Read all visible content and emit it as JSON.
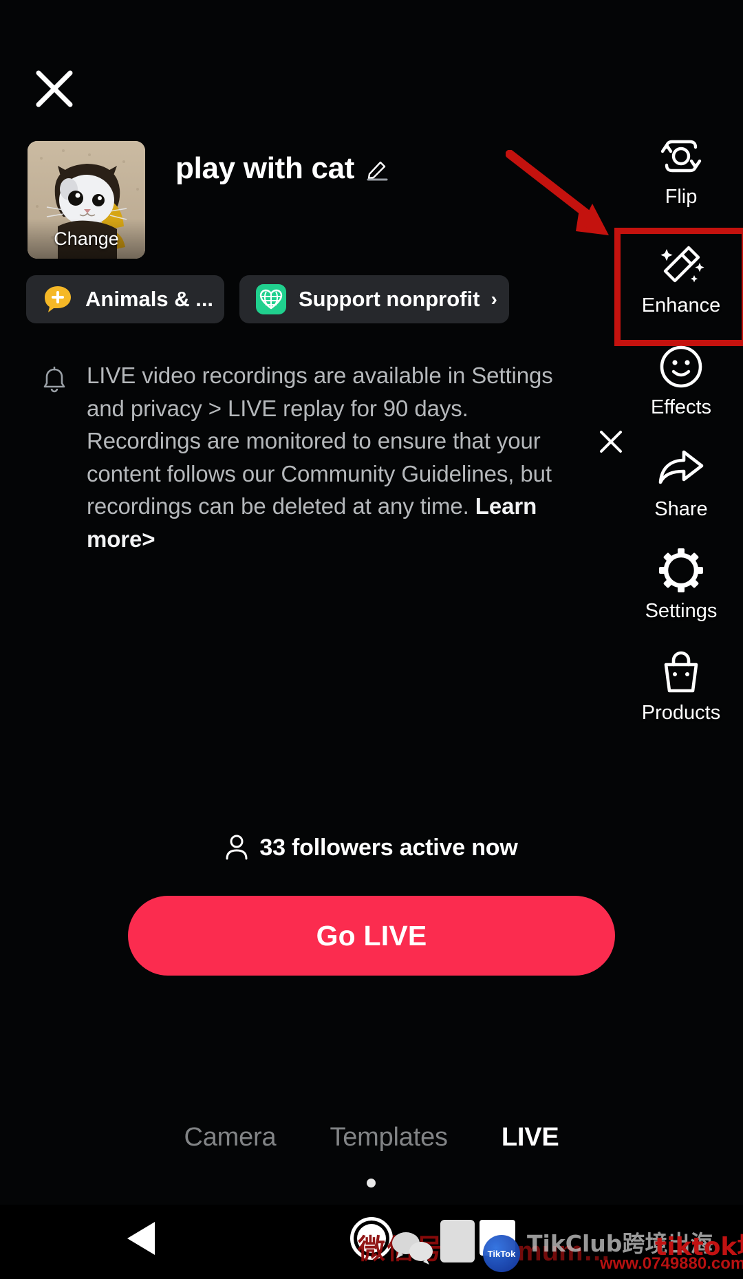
{
  "app": {
    "screen_name": "TikTok LIVE setup",
    "background_color": "#040506"
  },
  "header": {
    "close_icon": "close-icon",
    "cover": {
      "change_label": "Change",
      "alt": "cat thumbnail"
    },
    "title": "play with cat",
    "edit_icon": "pencil-icon"
  },
  "chips": [
    {
      "id": "category",
      "label": "Animals & ...",
      "icon": "topic-plus-icon",
      "icon_color": "#f5b827",
      "chevron": ""
    },
    {
      "id": "nonprofit",
      "label": "Support nonprofit",
      "icon": "globe-heart-icon",
      "icon_color": "#20d08e",
      "chevron": "›"
    }
  ],
  "notice": {
    "icon": "bell-icon",
    "text_part1": "LIVE video recordings are available in Settings and privacy > LIVE replay for 90 days. Recordings are monitored to ensure that your content follows our Community Guidelines, but recordings can be deleted at any time. ",
    "learn_more": "Learn more>",
    "close_icon": "close-icon"
  },
  "right_rail": [
    {
      "id": "flip",
      "label": "Flip",
      "icon": "camera-flip-icon",
      "highlighted": false
    },
    {
      "id": "enhance",
      "label": "Enhance",
      "icon": "magic-wand-icon",
      "highlighted": true
    },
    {
      "id": "effects",
      "label": "Effects",
      "icon": "smiley-face-icon",
      "highlighted": false
    },
    {
      "id": "share",
      "label": "Share",
      "icon": "share-arrow-icon",
      "highlighted": false
    },
    {
      "id": "settings",
      "label": "Settings",
      "icon": "gear-icon",
      "highlighted": false
    },
    {
      "id": "products",
      "label": "Products",
      "icon": "shopping-bag-icon",
      "highlighted": false
    }
  ],
  "annotation": {
    "arrow_color": "#c4120e",
    "highlight_color": "#c4120e",
    "target": "enhance"
  },
  "followers": {
    "icon": "person-icon",
    "text": "33 followers active now",
    "count": 33
  },
  "go_live": {
    "label": "Go LIVE",
    "color": "#fb2c4f"
  },
  "mode_tabs": [
    {
      "id": "camera",
      "label": "Camera",
      "active": false
    },
    {
      "id": "templates",
      "label": "Templates",
      "active": false
    },
    {
      "id": "live",
      "label": "LIVE",
      "active": true
    }
  ],
  "nav_bar": {
    "back_icon": "back-triangle-icon",
    "home_icon": "home-circle-icon",
    "recents_icon": "recents-square-icon"
  },
  "watermark": {
    "wechat_label": "微信号：",
    "handle": "mum…",
    "brand": "TikClub跨境出海",
    "red_cn": "tiktok培训",
    "url": "www.0749880.com",
    "badge": "TikTok"
  }
}
